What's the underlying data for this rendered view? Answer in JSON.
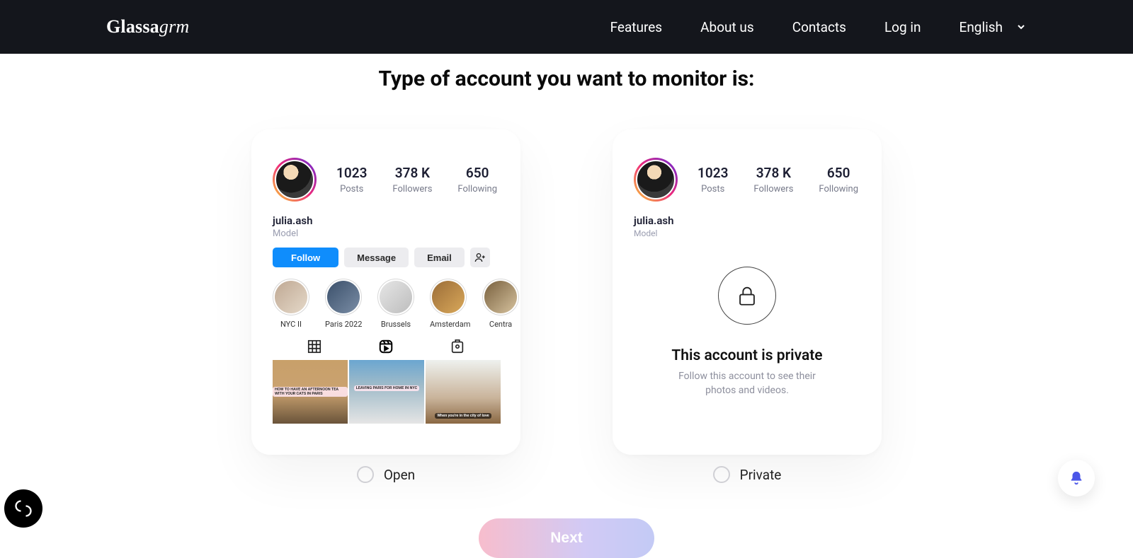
{
  "header": {
    "brand_primary": "Glassa",
    "brand_suffix": "grm",
    "nav": {
      "features": "Features",
      "about": "About us",
      "contacts": "Contacts",
      "login": "Log in",
      "language": "English"
    }
  },
  "title": "Type of account you want to monitor is:",
  "profile_open": {
    "username": "julia.ash",
    "bio": "Model",
    "stats": {
      "posts_value": "1023",
      "posts_label": "Posts",
      "followers_value": "378 K",
      "followers_label": "Followers",
      "following_value": "650",
      "following_label": "Following"
    },
    "buttons": {
      "follow": "Follow",
      "message": "Message",
      "email": "Email"
    },
    "highlights": [
      {
        "label": "NYC II"
      },
      {
        "label": "Paris 2022"
      },
      {
        "label": "Brussels"
      },
      {
        "label": "Amsterdam"
      },
      {
        "label": "Centra"
      }
    ],
    "feed_captions": {
      "c1": "HOW TO HAVE AN AFTERNOON TEA WITH YOUR CATS IN PARIS",
      "c2": "LEAVING PARIS FOR HOME IN NYC",
      "c3": "When you're in the city of love"
    }
  },
  "profile_private": {
    "username": "julia.ash",
    "bio": "Model",
    "stats": {
      "posts_value": "1023",
      "posts_label": "Posts",
      "followers_value": "378 K",
      "followers_label": "Followers",
      "following_value": "650",
      "following_label": "Following"
    },
    "locked_title": "This account is private",
    "locked_sub_line1": "Follow this account to see their",
    "locked_sub_line2": "photos and videos."
  },
  "options": {
    "open": "Open",
    "private": "Private"
  },
  "next": "Next"
}
